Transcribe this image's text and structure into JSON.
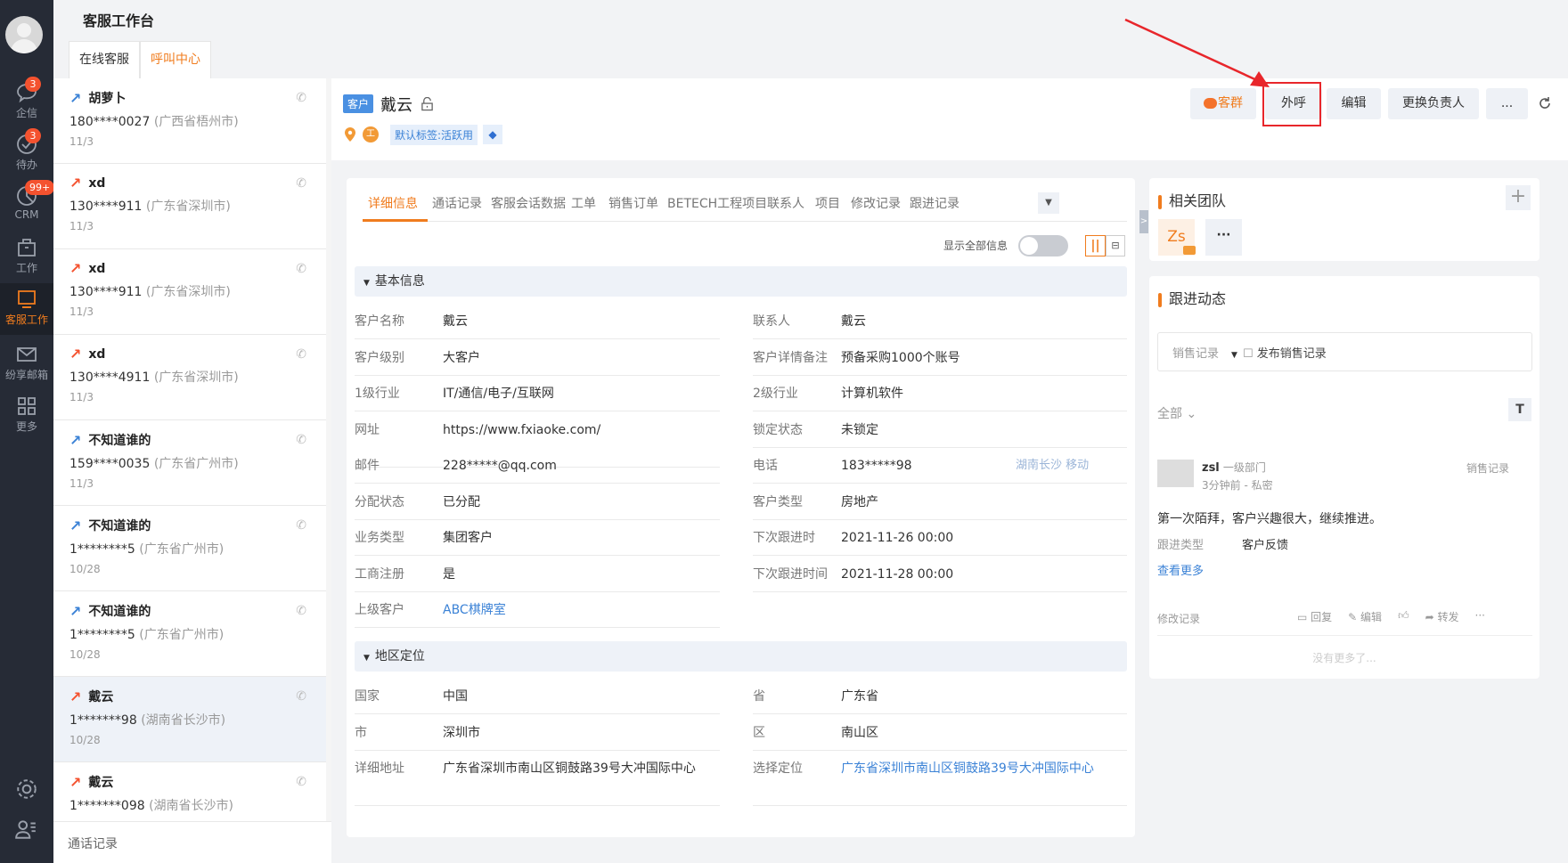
{
  "nav": {
    "items": [
      {
        "label": "企信",
        "badge": "3"
      },
      {
        "label": "待办",
        "badge": "3"
      },
      {
        "label": "CRM",
        "badge": "99+"
      },
      {
        "label": "工作"
      },
      {
        "label": "客服工作"
      },
      {
        "label": "纷享邮箱"
      },
      {
        "label": "更多"
      }
    ]
  },
  "page": {
    "title": "客服工作台",
    "tabs": [
      "在线客服",
      "呼叫中心"
    ],
    "active_tab": 1
  },
  "calls": [
    {
      "name": "胡萝卜",
      "dir": "in",
      "phone": "180****0027",
      "region": "(广西省梧州市)",
      "date": "11/3"
    },
    {
      "name": "xd",
      "dir": "out",
      "phone": "130****911",
      "region": "(广东省深圳市)",
      "date": "11/3"
    },
    {
      "name": "xd",
      "dir": "out",
      "phone": "130****911",
      "region": "(广东省深圳市)",
      "date": "11/3"
    },
    {
      "name": "xd",
      "dir": "out",
      "phone": "130****4911",
      "region": "(广东省深圳市)",
      "date": "11/3"
    },
    {
      "name": "不知道谁的",
      "dir": "in",
      "phone": "159****0035",
      "region": "(广东省广州市)",
      "date": "11/3"
    },
    {
      "name": "不知道谁的",
      "dir": "in",
      "phone": "1********5",
      "region": "(广东省广州市)",
      "date": "10/28"
    },
    {
      "name": "不知道谁的",
      "dir": "in",
      "phone": "1********5",
      "region": "(广东省广州市)",
      "date": "10/28"
    },
    {
      "name": "戴云",
      "dir": "out",
      "phone": "1*******98",
      "region": "(湖南省长沙市)",
      "date": "10/28",
      "selected": true
    },
    {
      "name": "戴云",
      "dir": "out",
      "phone": "1*******098",
      "region": "(湖南省长沙市)",
      "date": ""
    }
  ],
  "list_footer": "通话记录",
  "header": {
    "type_tag": "客户",
    "name": "戴云",
    "label_tag": "默认标签:活跃用",
    "buttons": {
      "group": "客群",
      "call": "外呼",
      "edit": "编辑",
      "change_owner": "更换负责人",
      "more": "..."
    }
  },
  "detail": {
    "tabs": [
      "详细信息",
      "通话记录",
      "客服会话数据",
      "工单",
      "销售订单",
      "BETECH工程项目",
      "联系人",
      "项目",
      "修改记录",
      "跟进记录"
    ],
    "show_all_label": "显示全部信息",
    "basic_title": "基本信息",
    "basic_left": [
      [
        "客户名称",
        "戴云"
      ],
      [
        "客户级别",
        "大客户"
      ],
      [
        "1级行业",
        "IT/通信/电子/互联网"
      ],
      [
        "网址",
        "https://www.fxiaoke.com/"
      ],
      [
        "邮件",
        "228*****@qq.com"
      ],
      [
        "分配状态",
        "已分配"
      ],
      [
        "业务类型",
        "集团客户"
      ],
      [
        "工商注册",
        "是"
      ],
      [
        "上级客户",
        "ABC棋牌室"
      ]
    ],
    "basic_right": [
      [
        "联系人",
        "戴云"
      ],
      [
        "客户详情备注",
        "预备采购1000个账号"
      ],
      [
        "2级行业",
        "计算机软件"
      ],
      [
        "锁定状态",
        "未锁定"
      ],
      [
        "电话",
        "183*****98"
      ],
      [
        "客户类型",
        "房地产"
      ],
      [
        "下次跟进时",
        "2021-11-26 00:00"
      ],
      [
        "下次跟进时间",
        "2021-11-28 00:00"
      ]
    ],
    "phone_location": "湖南长沙 移动",
    "region_title": "地区定位",
    "region_left": [
      [
        "国家",
        "中国"
      ],
      [
        "市",
        "深圳市"
      ],
      [
        "详细地址",
        "广东省深圳市南山区铜鼓路39号大冲国际中心"
      ]
    ],
    "region_right": [
      [
        "省",
        "广东省"
      ],
      [
        "区",
        "南山区"
      ],
      [
        "选择定位",
        "广东省深圳市南山区铜鼓路39号大冲国际中心"
      ]
    ]
  },
  "team": {
    "title": "相关团队",
    "member": "Zs"
  },
  "follow": {
    "title": "跟进动态",
    "record_type": "销售记录",
    "publish": "发布销售记录",
    "filter": "全部",
    "post": {
      "user": "zsl",
      "dept": "一级部门",
      "meta": "3分钟前 - 私密",
      "kind": "销售记录",
      "content": "第一次陌拜，客户兴趣很大，继续推进。",
      "field_label": "跟进类型",
      "field_value": "客户反馈",
      "more": "查看更多",
      "footer_left": "修改记录",
      "reply": "回复",
      "edit": "编辑",
      "forward": "转发"
    },
    "end": "没有更多了..."
  },
  "colors": {
    "accent": "#f07c1e",
    "nav_bg": "#262b36",
    "link": "#3b82d6",
    "highlight": "#e8262b"
  }
}
